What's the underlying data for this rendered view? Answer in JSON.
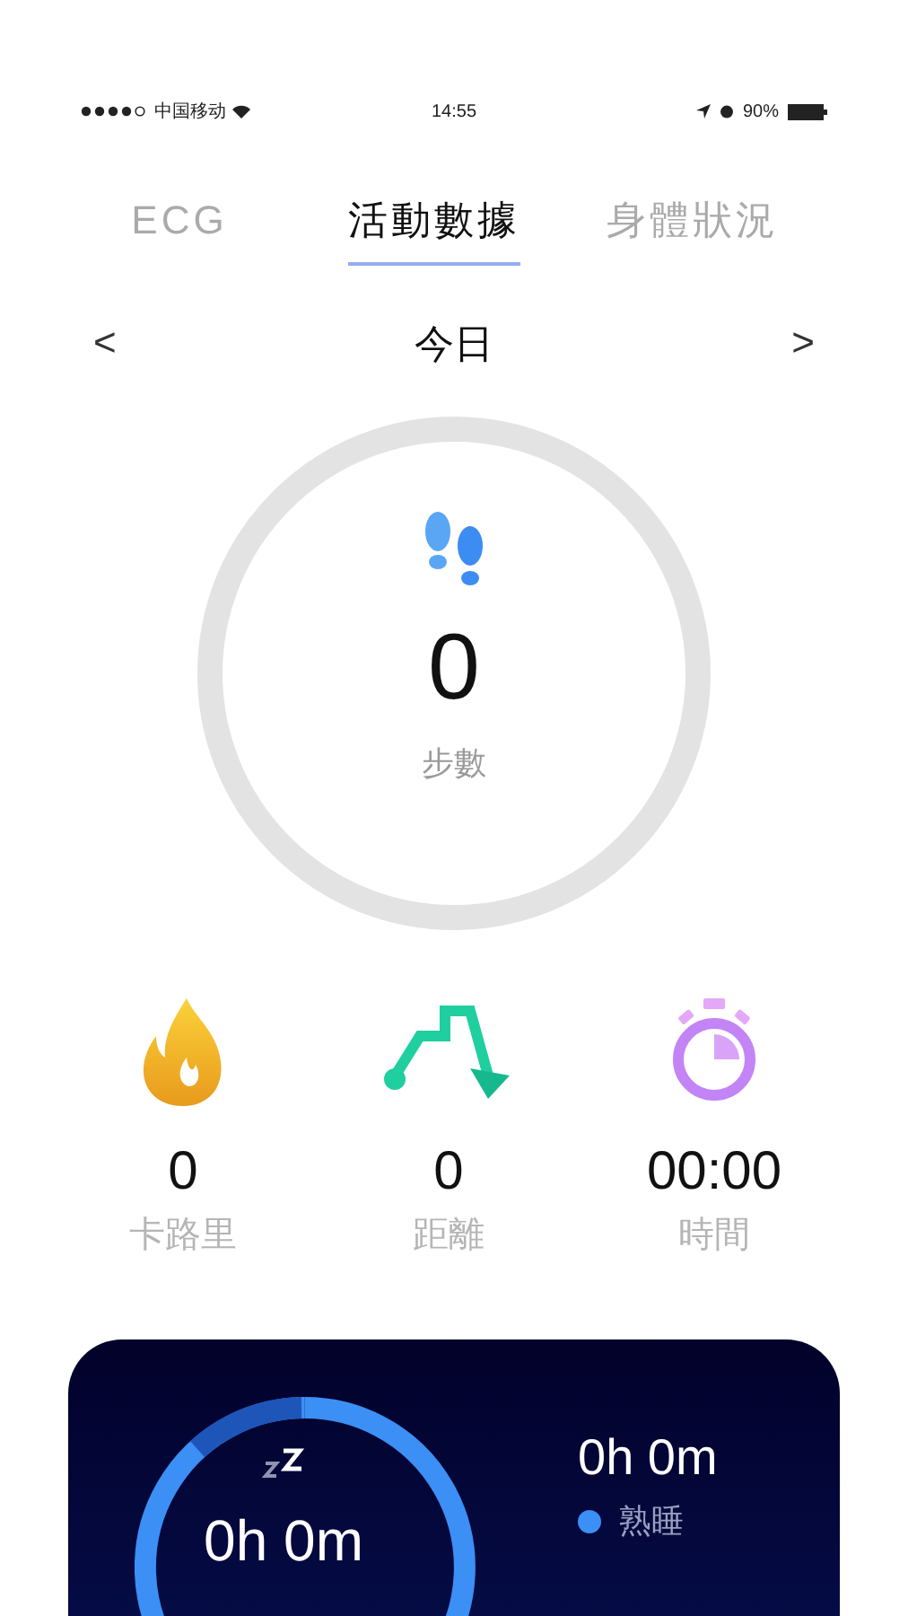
{
  "status_bar": {
    "carrier": "中国移动",
    "time": "14:55",
    "battery": "90%"
  },
  "tabs": [
    {
      "label": "ECG",
      "selected": false
    },
    {
      "label": "活動數據",
      "selected": true
    },
    {
      "label": "身體狀況",
      "selected": false
    }
  ],
  "date_nav": {
    "title": "今日",
    "prev": "<",
    "next": ">"
  },
  "steps": {
    "value": "0",
    "label": "步數"
  },
  "stats": [
    {
      "kind": "calories",
      "value": "0",
      "label": "卡路里"
    },
    {
      "kind": "distance",
      "value": "0",
      "label": "距離"
    },
    {
      "kind": "time",
      "value": "00:00",
      "label": "時間"
    }
  ],
  "sleep": {
    "total": "0h 0m",
    "stages": [
      {
        "value": "0h 0m",
        "label": "熟睡",
        "color": "#3b8ff5"
      }
    ]
  }
}
